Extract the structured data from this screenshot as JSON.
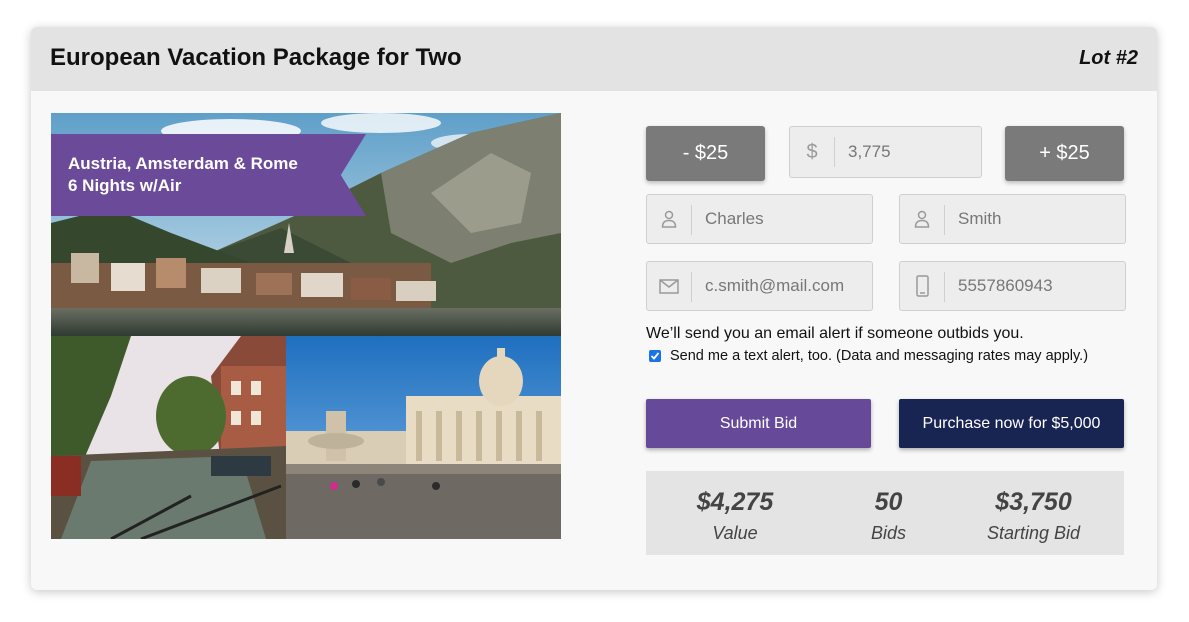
{
  "header": {
    "title": "European Vacation Package for Two",
    "lot": "Lot #2"
  },
  "banner": {
    "line1": "Austria, Amsterdam & Rome",
    "line2": "6 Nights w/Air"
  },
  "bid": {
    "decrement_label": "- $25",
    "increment_label": "+ $25",
    "currency_symbol": "$",
    "amount": "3,775"
  },
  "form": {
    "first_name": "Charles",
    "last_name": "Smith",
    "email": "c.smith@mail.com",
    "phone": "5557860943",
    "email_alert_note": "We’ll send you an email alert if someone outbids you.",
    "text_alert_label": "Send me a text alert, too. (Data and messaging rates may apply.)",
    "text_alert_checked": true
  },
  "actions": {
    "submit_label": "Submit Bid",
    "purchase_label": "Purchase now for $5,000"
  },
  "stats": [
    {
      "value": "$4,275",
      "label": "Value"
    },
    {
      "value": "50",
      "label": "Bids"
    },
    {
      "value": "$3,750",
      "label": "Starting Bid"
    }
  ],
  "colors": {
    "banner": "#6a4a99",
    "submit": "#67499a",
    "purchase": "#182452",
    "step_button": "#7a7a7a",
    "header_bg": "#e3e3e3",
    "stats_bg": "#e4e4e4"
  },
  "icons": {
    "dollar": "dollar-icon",
    "person": "person-icon",
    "mail": "mail-icon",
    "phone": "phone-icon"
  }
}
